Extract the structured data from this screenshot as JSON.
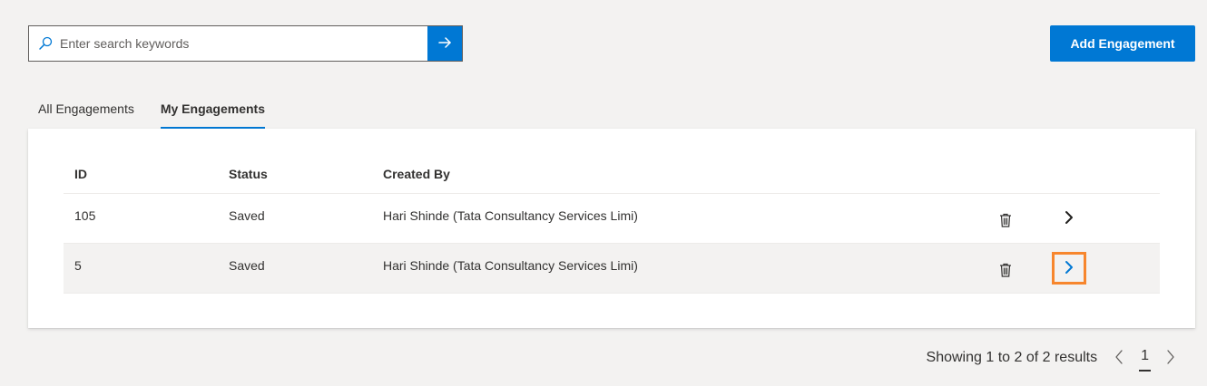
{
  "search": {
    "placeholder": "Enter search keywords",
    "value": ""
  },
  "header": {
    "add_button_label": "Add Engagement"
  },
  "tabs": [
    {
      "label": "All Engagements",
      "active": false
    },
    {
      "label": "My Engagements",
      "active": true
    }
  ],
  "table": {
    "columns": [
      "ID",
      "Status",
      "Created By"
    ],
    "rows": [
      {
        "id": "105",
        "status": "Saved",
        "created_by": "Hari Shinde (Tata Consultancy Services Limi)"
      },
      {
        "id": "5",
        "status": "Saved",
        "created_by": "Hari Shinde (Tata Consultancy Services Limi)"
      }
    ]
  },
  "pagination": {
    "summary": "Showing 1 to 2 of 2 results",
    "current_page": "1"
  },
  "colors": {
    "accent": "#0078d4",
    "focus_outline": "#f7862d",
    "background": "#f3f2f1"
  },
  "icons": {
    "search": "search-icon",
    "go": "arrow-right-icon",
    "delete": "trash-icon",
    "open": "chevron-right-icon",
    "prev": "chevron-left-icon",
    "next": "chevron-right-icon"
  }
}
